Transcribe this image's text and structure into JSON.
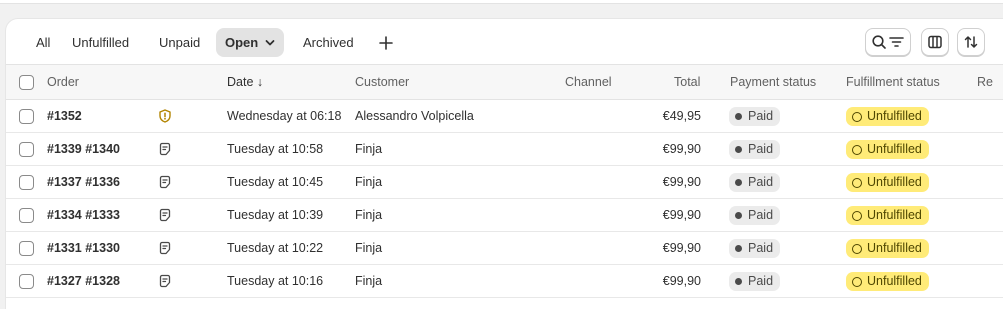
{
  "tabs": [
    {
      "label": "All",
      "active": false
    },
    {
      "label": "Unfulfilled",
      "active": false
    },
    {
      "label": "Unpaid",
      "active": false
    },
    {
      "label": "Open",
      "active": true
    },
    {
      "label": "Archived",
      "active": false
    }
  ],
  "toolbar": {
    "add_view_icon": "plus-icon",
    "search_filter_icon": "search-filter-icon",
    "columns_icon": "columns-icon",
    "sort_icon": "sort-icon"
  },
  "columns": {
    "order": "Order",
    "date": "Date ↓",
    "customer": "Customer",
    "channel": "Channel",
    "total": "Total",
    "payment_status": "Payment status",
    "fulfillment_status": "Fulfillment status",
    "truncated": "Re"
  },
  "orders": [
    {
      "order": "#1352",
      "icon": "alert-shield-icon",
      "date": "Wednesday at 06:18",
      "customer": "Alessandro Volpicella",
      "channel": "",
      "total": "€49,95",
      "payment_status": "Paid",
      "fulfillment_status": "Unfulfilled"
    },
    {
      "order": "#1339 #1340",
      "icon": "note-icon",
      "date": "Tuesday at 10:58",
      "customer": "Finja",
      "channel": "",
      "total": "€99,90",
      "payment_status": "Paid",
      "fulfillment_status": "Unfulfilled"
    },
    {
      "order": "#1337 #1336",
      "icon": "note-icon",
      "date": "Tuesday at 10:45",
      "customer": "Finja",
      "channel": "",
      "total": "€99,90",
      "payment_status": "Paid",
      "fulfillment_status": "Unfulfilled"
    },
    {
      "order": "#1334 #1333",
      "icon": "note-icon",
      "date": "Tuesday at 10:39",
      "customer": "Finja",
      "channel": "",
      "total": "€99,90",
      "payment_status": "Paid",
      "fulfillment_status": "Unfulfilled"
    },
    {
      "order": "#1331 #1330",
      "icon": "note-icon",
      "date": "Tuesday at 10:22",
      "customer": "Finja",
      "channel": "",
      "total": "€99,90",
      "payment_status": "Paid",
      "fulfillment_status": "Unfulfilled"
    },
    {
      "order": "#1327 #1328",
      "icon": "note-icon",
      "date": "Tuesday at 10:16",
      "customer": "Finja",
      "channel": "",
      "total": "€99,90",
      "payment_status": "Paid",
      "fulfillment_status": "Unfulfilled"
    }
  ],
  "colors": {
    "unfulfilled_badge": "#ffeb78",
    "paid_badge": "#ebebeb",
    "alert_icon": "#b28400"
  }
}
